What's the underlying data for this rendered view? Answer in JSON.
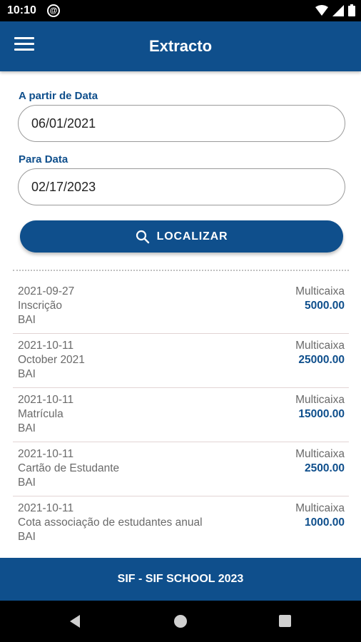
{
  "status": {
    "time": "10:10",
    "notification_glyph": "@"
  },
  "app_bar": {
    "title": "Extracto"
  },
  "filters": {
    "from_label": "A partir de Data",
    "from_value": "06/01/2021",
    "to_label": "Para Data",
    "to_value": "02/17/2023",
    "search_button": "LOCALIZAR"
  },
  "transactions": [
    {
      "date": "2021-09-27",
      "description": "Inscrição",
      "bank": "BAI",
      "method": "Multicaixa",
      "amount": "5000.00"
    },
    {
      "date": "2021-10-11",
      "description": "October 2021",
      "bank": "BAI",
      "method": "Multicaixa",
      "amount": "25000.00"
    },
    {
      "date": "2021-10-11",
      "description": "Matrícula",
      "bank": "BAI",
      "method": "Multicaixa",
      "amount": "15000.00"
    },
    {
      "date": "2021-10-11",
      "description": "Cartão de Estudante",
      "bank": "BAI",
      "method": "Multicaixa",
      "amount": "2500.00"
    },
    {
      "date": "2021-10-11",
      "description": "Cota associação de estudantes anual",
      "bank": "BAI",
      "method": "Multicaixa",
      "amount": "1000.00"
    }
  ],
  "footer": {
    "text": "SIF - SIF SCHOOL 2023"
  },
  "colors": {
    "primary": "#0f4f8c",
    "text_muted": "#6a6a6a"
  }
}
